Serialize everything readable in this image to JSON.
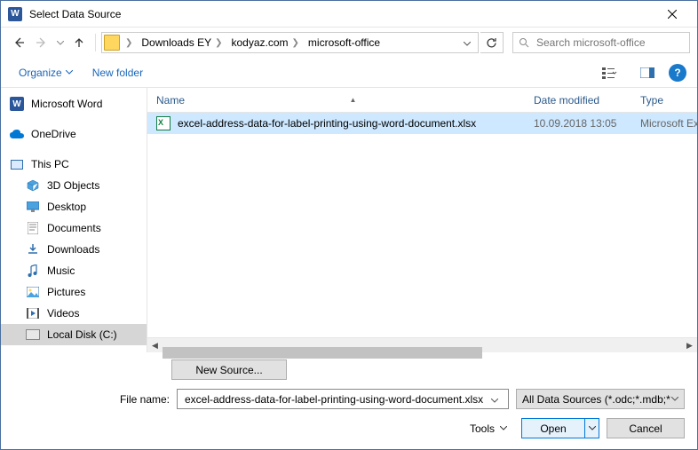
{
  "window": {
    "title": "Select Data Source"
  },
  "breadcrumbs": {
    "b1": "Downloads EY",
    "b2": "kodyaz.com",
    "b3": "microsoft-office"
  },
  "search": {
    "placeholder": "Search microsoft-office"
  },
  "toolbar": {
    "organize": "Organize",
    "new_folder": "New folder"
  },
  "sidebar": {
    "word": "Microsoft Word",
    "onedrive": "OneDrive",
    "thispc": "This PC",
    "objects3d": "3D Objects",
    "desktop": "Desktop",
    "documents": "Documents",
    "downloads": "Downloads",
    "music": "Music",
    "pictures": "Pictures",
    "videos": "Videos",
    "localdisk": "Local Disk (C:)"
  },
  "columns": {
    "name": "Name",
    "date": "Date modified",
    "type": "Type"
  },
  "files": {
    "f0": {
      "name": "excel-address-data-for-label-printing-using-word-document.xlsx",
      "date": "10.09.2018 13:05",
      "type": "Microsoft Exce"
    }
  },
  "buttons": {
    "new_source": "New Source...",
    "tools": "Tools",
    "open": "Open",
    "cancel": "Cancel"
  },
  "filename": {
    "label": "File name:",
    "value": "excel-address-data-for-label-printing-using-word-document.xlsx"
  },
  "filter": {
    "text": "All Data Sources (*.odc;*.mdb;*"
  }
}
